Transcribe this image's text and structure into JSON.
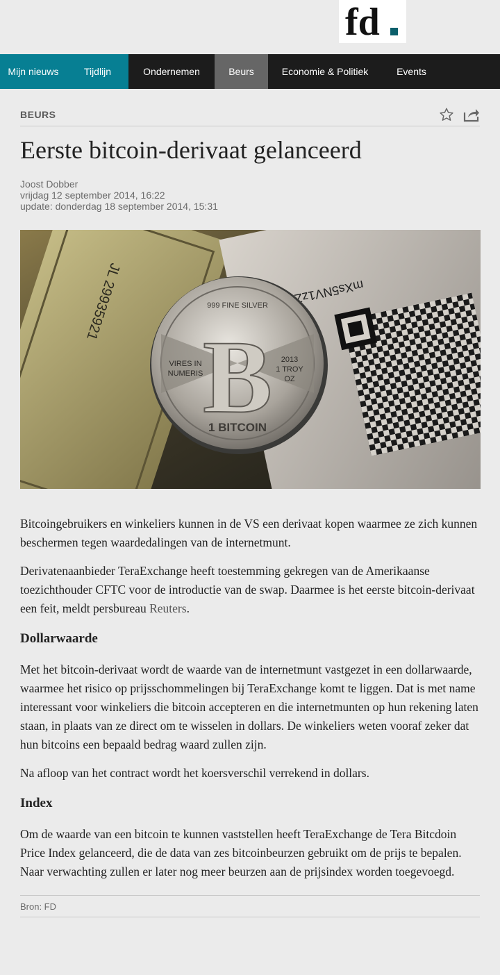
{
  "header": {
    "logo_text": "fd",
    "logo_dot_color": "#0b5f6b"
  },
  "nav": {
    "items": [
      {
        "label": "Mijn nieuws"
      },
      {
        "label": "Tijdlijn"
      },
      {
        "label": "Ondernemen"
      },
      {
        "label": "Beurs"
      },
      {
        "label": "Economie & Politiek"
      },
      {
        "label": "Events"
      }
    ],
    "active": "Beurs"
  },
  "article": {
    "section": "BEURS",
    "title": "Eerste bitcoin-derivaat gelanceerd",
    "author": "Joost Dobber",
    "published": "vrijdag 12 september 2014, 16:22",
    "updated": "update: donderdag 18 september 2014, 15:31",
    "image": {
      "coin_top_text": "999 FINE SILVER",
      "coin_left_text_1": "VIRES IN",
      "coin_left_text_2": "NUMERIS",
      "coin_right_year": "2013",
      "coin_right_text_1": "1 TROY",
      "coin_right_text_2": "OZ",
      "coin_bottom_text": "1 BITCOIN",
      "coin_symbol": "B",
      "banknote_serial": "JL 29935921",
      "wallet_text": "mXs5NV1zZwxM"
    },
    "p1": "Bitcoingebruikers en winkeliers kunnen in de VS een derivaat kopen waarmee ze zich kunnen beschermen tegen waardedalingen van de internetmunt.",
    "p2_before": "Derivatenaanbieder TeraExchange heeft toestemming gekregen van de Amerikaanse toezichthouder CFTC voor de introductie van de swap. Daarmee is het eerste bitcoin-derivaat een feit, meldt persbureau ",
    "p2_link": "Reuters",
    "p2_after": ".",
    "subhead1": "Dollarwaarde",
    "p3": "Met het bitcoin-derivaat wordt de waarde van de internetmunt vastgezet in een dollarwaarde, waarmee het risico op prijsschommelingen bij TeraExchange komt te liggen. Dat is met name interessant voor winkeliers die bitcoin accepteren en die internetmunten op hun rekening laten staan, in plaats van ze direct om te wisselen in dollars. De winkeliers weten vooraf zeker dat hun bitcoins een bepaald bedrag waard zullen zijn.",
    "p4": "Na afloop van het contract wordt het koersverschil verrekend in dollars.",
    "subhead2": "Index",
    "p5": "Om de waarde van een bitcoin te kunnen vaststellen heeft TeraExchange de Tera Bitcdoin Price Index gelanceerd, die de data van zes bitcoinbeurzen gebruikt om de prijs te bepalen. Naar verwachting zullen er later nog meer beurzen aan de prijsindex worden toegevoegd.",
    "source": "Bron: FD"
  },
  "colors": {
    "nav_bg": "#1c1c1c",
    "nav_teal": "#077f93",
    "nav_active": "#666666",
    "page_bg": "#ebebeb"
  }
}
